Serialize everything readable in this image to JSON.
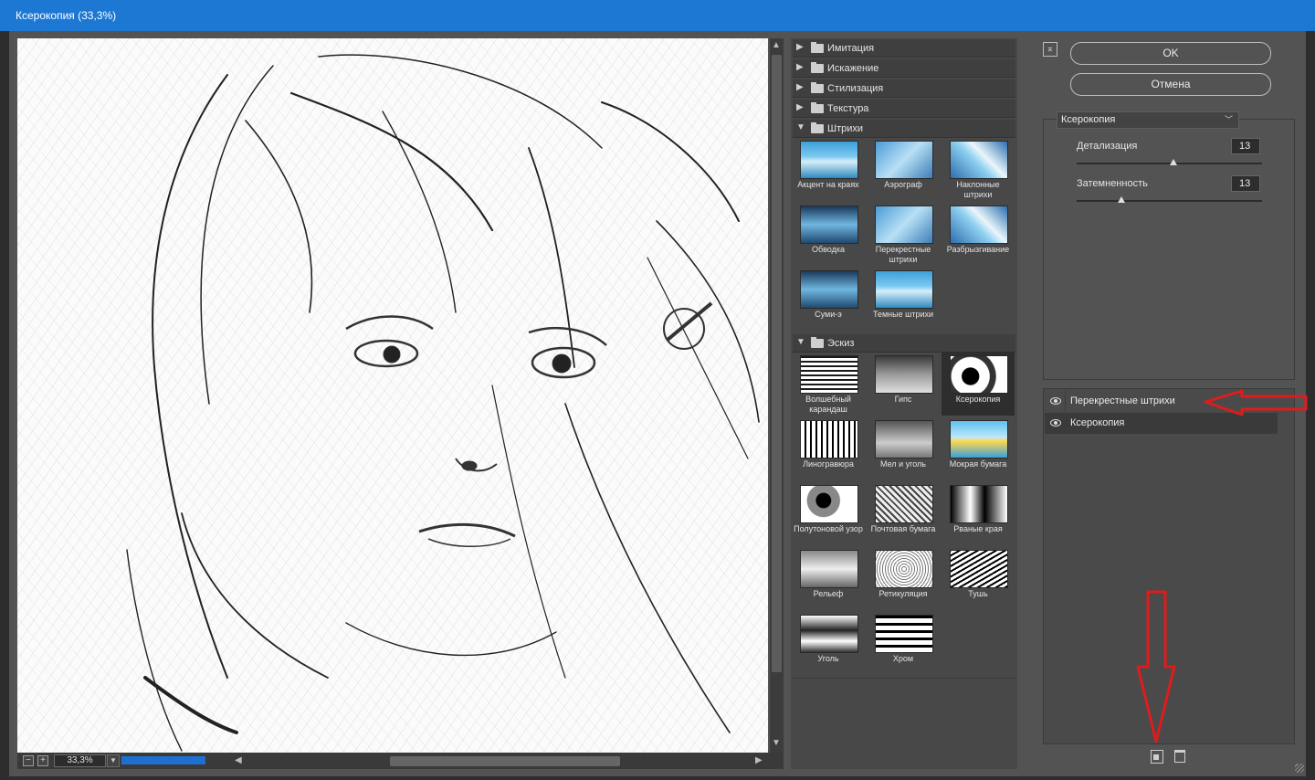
{
  "window": {
    "title": "Ксерокопия (33,3%)"
  },
  "preview": {
    "zoom": "33,3%",
    "zoom_out": "−",
    "zoom_in": "+"
  },
  "gallery": {
    "categories": [
      {
        "label": "Имитация",
        "expanded": false
      },
      {
        "label": "Искажение",
        "expanded": false
      },
      {
        "label": "Стилизация",
        "expanded": false
      },
      {
        "label": "Текстура",
        "expanded": false
      },
      {
        "label": "Штрихи",
        "expanded": true
      },
      {
        "label": "Эскиз",
        "expanded": true
      }
    ],
    "strokes": [
      {
        "label": "Акцент на краях"
      },
      {
        "label": "Аэрограф"
      },
      {
        "label": "Наклонные штрихи"
      },
      {
        "label": "Обводка"
      },
      {
        "label": "Перекрестные штрихи"
      },
      {
        "label": "Разбрызгивание"
      },
      {
        "label": "Суми-э"
      },
      {
        "label": "Темные штрихи"
      }
    ],
    "sketch": [
      {
        "label": "Волшебный карандаш"
      },
      {
        "label": "Гипс"
      },
      {
        "label": "Ксерокопия"
      },
      {
        "label": "Линогравюра"
      },
      {
        "label": "Мел и уголь"
      },
      {
        "label": "Мокрая бумага"
      },
      {
        "label": "Полутоновой узор"
      },
      {
        "label": "Почтовая бумага"
      },
      {
        "label": "Рваные края"
      },
      {
        "label": "Рельеф"
      },
      {
        "label": "Ретикуляция"
      },
      {
        "label": "Тушь"
      },
      {
        "label": "Уголь"
      },
      {
        "label": "Хром"
      }
    ]
  },
  "actions": {
    "ok": "OK",
    "cancel": "Отмена"
  },
  "settings": {
    "filter": "Ксерокопия",
    "params": [
      {
        "label": "Детализация",
        "value": "13",
        "fraction": 0.52
      },
      {
        "label": "Затемненность",
        "value": "13",
        "fraction": 0.24
      }
    ]
  },
  "layers": [
    {
      "label": "Перекрестные штрихи",
      "active": false
    },
    {
      "label": "Ксерокопия",
      "active": true
    }
  ],
  "colors": {
    "title_bar": "#1d78d4",
    "dialog": "#535353",
    "annotation": "#e01b1b"
  }
}
